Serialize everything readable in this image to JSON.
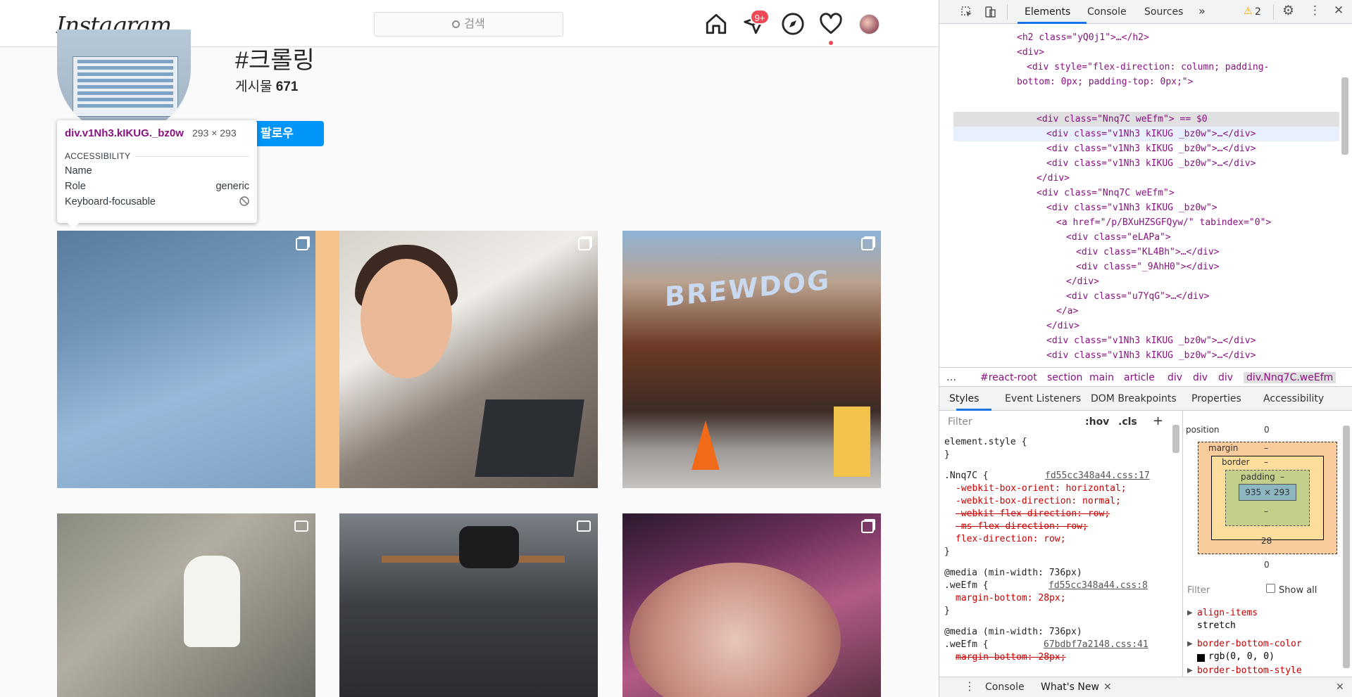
{
  "instagram": {
    "logo": "Instagram",
    "search_placeholder": "검색",
    "dm_badge": "9+",
    "hashtag": "#크롤링",
    "posts_label": "게시물",
    "posts_count": "671",
    "follow_label": "팔로우",
    "tile_brand": "BREWDOG"
  },
  "tooltip": {
    "selector": "div.v1Nh3.kIKUG._bz0w",
    "size": "293 × 293",
    "section": "ACCESSIBILITY",
    "rows": [
      {
        "k": "Name",
        "v": ""
      },
      {
        "k": "Role",
        "v": "generic"
      },
      {
        "k": "Keyboard-focusable",
        "v": ""
      }
    ]
  },
  "devtools": {
    "tabs": [
      "Elements",
      "Console",
      "Sources"
    ],
    "more_tabs": "»",
    "warn_count": "2",
    "dom": [
      "<h2 class=\"yQ0j1\">…</h2>",
      "<div>",
      "<div style=\"flex-direction: column; padding-",
      "bottom: 0px; padding-top: 0px;\">",
      "<div class=\"Nnq7C weEfm\"> == $0",
      "<div class=\"v1Nh3 kIKUG  _bz0w\">…</div>",
      "<div class=\"v1Nh3 kIKUG  _bz0w\">…</div>",
      "<div class=\"v1Nh3 kIKUG  _bz0w\">…</div>",
      "</div>",
      "<div class=\"Nnq7C weEfm\">",
      "<div class=\"v1Nh3 kIKUG  _bz0w\">",
      "<a href=\"/p/BXuHZSGFQyw/\" tabindex=\"0\">",
      "<div class=\"eLAPa\">",
      "<div class=\"KL4Bh\">…</div>",
      "<div class=\"_9AhH0\"></div>",
      "</div>",
      "<div class=\"u7YqG\">…</div>",
      "</a>",
      "</div>",
      "<div class=\"v1Nh3 kIKUG  _bz0w\">…</div>",
      "<div class=\"v1Nh3 kIKUG  _bz0w\">…</div>",
      "</div>",
      "<div class=\"Nnq7C weEfm\">…</div>"
    ],
    "breadcrumbs": [
      "…",
      "#react-root",
      "section",
      "main",
      "article",
      "div",
      "div",
      "div",
      "div.Nnq7C.weEfm"
    ],
    "style_tabs": [
      "Styles",
      "Event Listeners",
      "DOM Breakpoints",
      "Properties",
      "Accessibility"
    ],
    "filter_placeholder": "Filter",
    "hov": ":hov",
    "cls": ".cls",
    "plus": "+",
    "rules": [
      "element.style {",
      "}",
      ".Nnq7C {",
      "-webkit-box-orient: horizontal;",
      "-webkit-box-direction: normal;",
      "-webkit-flex-direction: row;",
      "-ms-flex-direction: row;",
      "flex-direction: row;",
      "}",
      "@media (min-width: 736px)",
      ".weEfm {",
      "margin-bottom: 28px;",
      "}",
      "@media (min-width: 736px)",
      ".weEfm {",
      "margin-bottom: 28px;"
    ],
    "rule_sources": [
      "fd55cc348a44.css:17",
      "fd55cc348a44.css:8",
      "67bdbf7a2148.css:41"
    ],
    "box": {
      "position_label": "position",
      "position_val": "0",
      "margin_label": "margin",
      "border_label": "border",
      "padding_label": "padding",
      "content": "935 × 293",
      "dash": "–",
      "margin_bottom": "28",
      "bottom": "0"
    },
    "computed_filter": "Filter",
    "show_all": "Show all",
    "computed": [
      {
        "name": "align-items",
        "value": "stretch"
      },
      {
        "name": "border-bottom-color",
        "value": "rgb(0, 0, 0)"
      },
      {
        "name": "border-bottom-style",
        "value": ""
      }
    ],
    "drawer_tabs": [
      "Console",
      "What's New"
    ]
  },
  "colors": {
    "ig_blue": "#0095f6",
    "badge": "#ed4956",
    "devtools_accent": "#1a73e8"
  }
}
